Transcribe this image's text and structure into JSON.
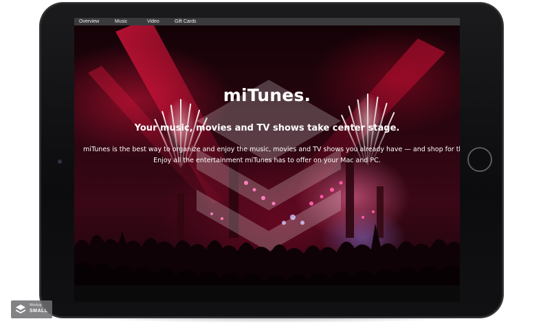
{
  "nav": {
    "items": [
      {
        "label": "Overview"
      },
      {
        "label": "Music"
      },
      {
        "label": "Video"
      },
      {
        "label": "Gift Cards"
      }
    ]
  },
  "hero": {
    "title": "miTunes.",
    "subtitle": "Your music, movies and TV shows take center stage.",
    "description_line1": "miTunes is the best way to organize and enjoy the music, movies and TV shows you already have — and shop for the ones you want",
    "description_line2": "Enjoy all the entertainment miTunes has to offer on your Mac and PC."
  },
  "badge": {
    "line1": "Mockup",
    "line2": "SMALL"
  },
  "colors": {
    "nav_bg": "#3a3a3c",
    "text": "#ffffff",
    "accent_red": "#c2103a",
    "tablet_frame": "#0c0c0e"
  },
  "icons": [
    "layers-logo-icon",
    "home-button-icon",
    "camera-icon"
  ]
}
